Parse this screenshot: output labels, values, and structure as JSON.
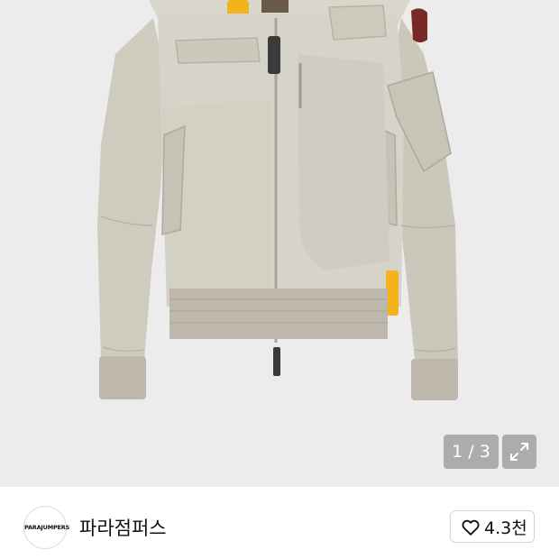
{
  "gallery": {
    "counter_text": "1 / 3",
    "current_index": 1,
    "total": 3,
    "expand_icon": "expand-arrows-icon",
    "background_color": "#ececec",
    "product_color": "#d2cfc4",
    "accent_color": "#f2b31c"
  },
  "shop": {
    "logo_text": "PARAJUMPERS",
    "name": "파라점퍼스",
    "like_icon": "heart-outline-icon",
    "like_count": "4.3천"
  }
}
